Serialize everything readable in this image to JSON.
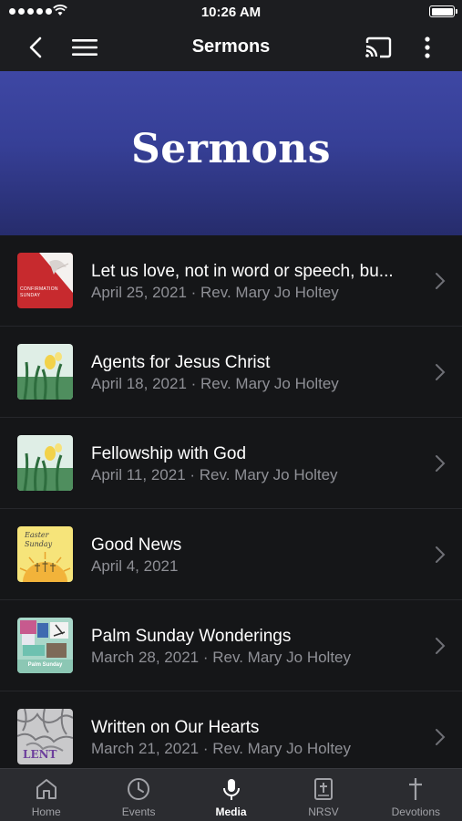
{
  "status": {
    "time": "10:26 AM"
  },
  "nav": {
    "title": "Sermons",
    "icons": [
      "back-icon",
      "menu-icon",
      "cast-icon",
      "more-icon"
    ]
  },
  "banner": {
    "title": "Sermons",
    "color": "#3a429e"
  },
  "sermons": [
    {
      "title": "Let us love, not in word or speech, bu...",
      "subtitle": "April 25, 2021 · Rev. Mary Jo Holtey",
      "thumb_text": "CONFIRMATION SUNDAY"
    },
    {
      "title": "Agents for Jesus Christ",
      "subtitle": "April 18, 2021 · Rev. Mary Jo Holtey"
    },
    {
      "title": "Fellowship with God",
      "subtitle": "April 11, 2021 · Rev. Mary Jo Holtey"
    },
    {
      "title": "Good News",
      "subtitle": "April 4, 2021",
      "thumb_text": "Easter Sunday"
    },
    {
      "title": "Palm Sunday Wonderings",
      "subtitle": "March 28, 2021 · Rev. Mary Jo Holtey",
      "thumb_text": "Palm Sunday"
    },
    {
      "title": "Written on Our Hearts",
      "subtitle": "March 21, 2021 · Rev. Mary Jo Holtey",
      "thumb_text": "LENT"
    }
  ],
  "tabs": [
    {
      "label": "Home",
      "icon": "home-icon"
    },
    {
      "label": "Events",
      "icon": "clock-icon"
    },
    {
      "label": "Media",
      "icon": "microphone-icon",
      "active": true
    },
    {
      "label": "NRSV",
      "icon": "bible-icon"
    },
    {
      "label": "Devotions",
      "icon": "cross-icon"
    }
  ]
}
